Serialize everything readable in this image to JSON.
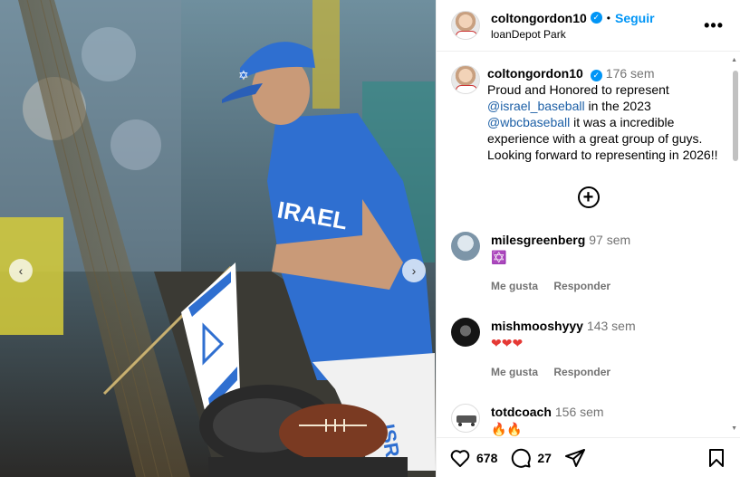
{
  "header": {
    "username": "coltongordon10",
    "follow_label": "Seguir",
    "location": "loanDepot Park",
    "separator": "•"
  },
  "caption": {
    "username": "coltongordon10",
    "time": "176 sem",
    "text_1": "Proud and Honored to represent",
    "mention_1": "@israel_baseball",
    "text_2": " in the 2023",
    "mention_2": "@wbcbaseball",
    "text_3": " it was a incredible experience with a great group of guys. Looking forward to representing in 2026!!"
  },
  "comments": [
    {
      "username": "milesgreenberg",
      "time": "97 sem",
      "text": "✡️",
      "like_label": "Me gusta",
      "reply_label": "Responder"
    },
    {
      "username": "mishmooshyyy",
      "time": "143 sem",
      "text": "❤❤❤",
      "like_label": "Me gusta",
      "reply_label": "Responder"
    },
    {
      "username": "totdcoach",
      "time": "156 sem",
      "text": "🔥🔥"
    }
  ],
  "footer": {
    "likes": "678",
    "comments": "27"
  },
  "icons": {
    "prev": "chevron-left-icon",
    "next": "chevron-right-icon",
    "more": "more-options-icon",
    "add": "add-comment-icon",
    "like": "heart-icon",
    "comment": "comment-icon",
    "share": "share-icon",
    "save": "bookmark-icon"
  },
  "colors": {
    "accent": "#0095f6",
    "mention": "#1c5fa6",
    "jersey_blue": "#2f6fd0"
  }
}
